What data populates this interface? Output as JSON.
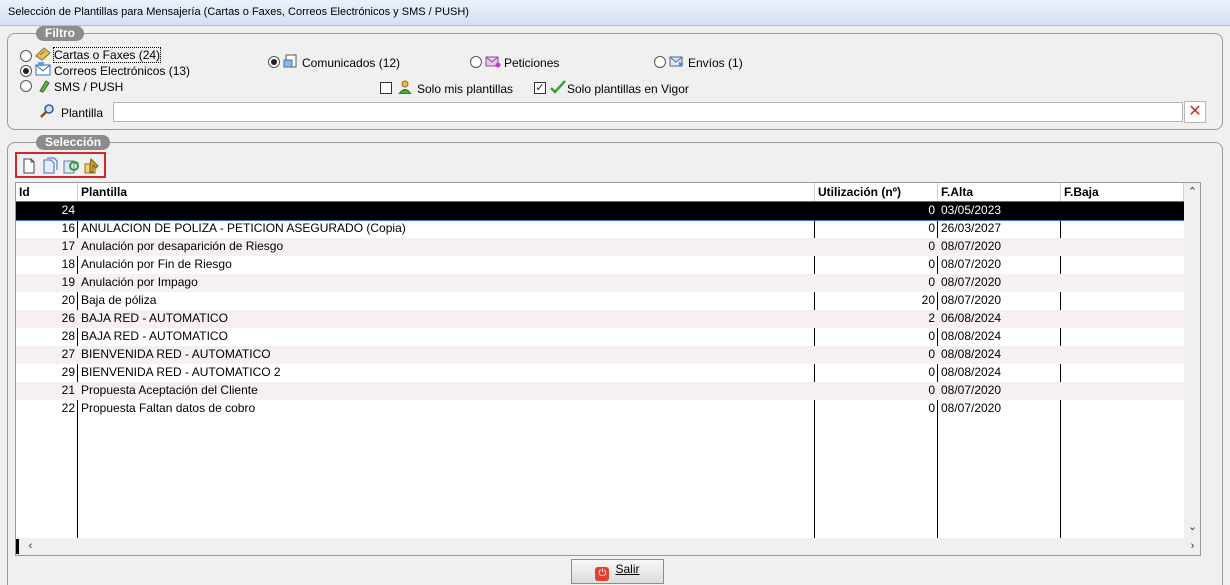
{
  "window": {
    "title": "Selección de Plantillas para Mensajería (Cartas o Faxes, Correos Electrónicos y SMS / PUSH)"
  },
  "filtro": {
    "legend": "Filtro",
    "tipos": [
      {
        "label": "Cartas o Faxes (24)",
        "selected": false,
        "icon": "letter-icon"
      },
      {
        "label": "Correos Electrónicos (13)",
        "selected": true,
        "icon": "email-icon"
      },
      {
        "label": "SMS / PUSH",
        "selected": false,
        "icon": "phone-icon"
      }
    ],
    "categorias": [
      {
        "label": "Comunicados (12)",
        "selected": true,
        "icon": "document-icon"
      },
      {
        "label": "Peticiones",
        "selected": false,
        "icon": "envelope-icon"
      },
      {
        "label": "Envíos (1)",
        "selected": false,
        "icon": "send-icon"
      }
    ],
    "solo_mis_plantillas": {
      "label": "Solo mis plantillas",
      "checked": false
    },
    "solo_vigor": {
      "label": "Solo plantillas en Vigor",
      "checked": true
    },
    "plantilla_label": "Plantilla",
    "plantilla_value": ""
  },
  "seleccion": {
    "legend": "Selección",
    "toolbar": [
      "new-document-icon",
      "copy-document-icon",
      "refresh-icon",
      "assign-icon"
    ],
    "columns": [
      "Id",
      "Plantilla",
      "Utilización (nº)",
      "F.Alta",
      "F.Baja"
    ],
    "rows": [
      {
        "id": "24",
        "plantilla": "",
        "uso": "0",
        "alta": "03/05/2023",
        "baja": "",
        "selected": true
      },
      {
        "id": "16",
        "plantilla": "ANULACION DE POLIZA - PETICION ASEGURADO (Copia)",
        "uso": "0",
        "alta": "26/03/2027",
        "baja": ""
      },
      {
        "id": "17",
        "plantilla": "Anulación por desaparición de Riesgo",
        "uso": "0",
        "alta": "08/07/2020",
        "baja": ""
      },
      {
        "id": "18",
        "plantilla": "Anulación por Fin de Riesgo",
        "uso": "0",
        "alta": "08/07/2020",
        "baja": ""
      },
      {
        "id": "19",
        "plantilla": "Anulación por Impago",
        "uso": "0",
        "alta": "08/07/2020",
        "baja": ""
      },
      {
        "id": "20",
        "plantilla": "Baja de póliza",
        "uso": "20",
        "alta": "08/07/2020",
        "baja": ""
      },
      {
        "id": "26",
        "plantilla": "BAJA RED - AUTOMATICO",
        "uso": "2",
        "alta": "06/08/2024",
        "baja": ""
      },
      {
        "id": "28",
        "plantilla": "BAJA RED - AUTOMATICO",
        "uso": "0",
        "alta": "08/08/2024",
        "baja": ""
      },
      {
        "id": "27",
        "plantilla": "BIENVENIDA RED - AUTOMATICO",
        "uso": "0",
        "alta": "08/08/2024",
        "baja": ""
      },
      {
        "id": "29",
        "plantilla": "BIENVENIDA RED - AUTOMATICO 2",
        "uso": "0",
        "alta": "08/08/2024",
        "baja": ""
      },
      {
        "id": "21",
        "plantilla": "Propuesta Aceptación del Cliente",
        "uso": "0",
        "alta": "08/07/2020",
        "baja": ""
      },
      {
        "id": "22",
        "plantilla": "Propuesta Faltan datos de cobro",
        "uso": "0",
        "alta": "08/07/2020",
        "baja": ""
      }
    ]
  },
  "footer": {
    "salir_label": "Salir"
  },
  "colors": {
    "accent_border": "#cf2a2a",
    "selected_row": "#000000",
    "alt_row": "#f6eff4"
  }
}
